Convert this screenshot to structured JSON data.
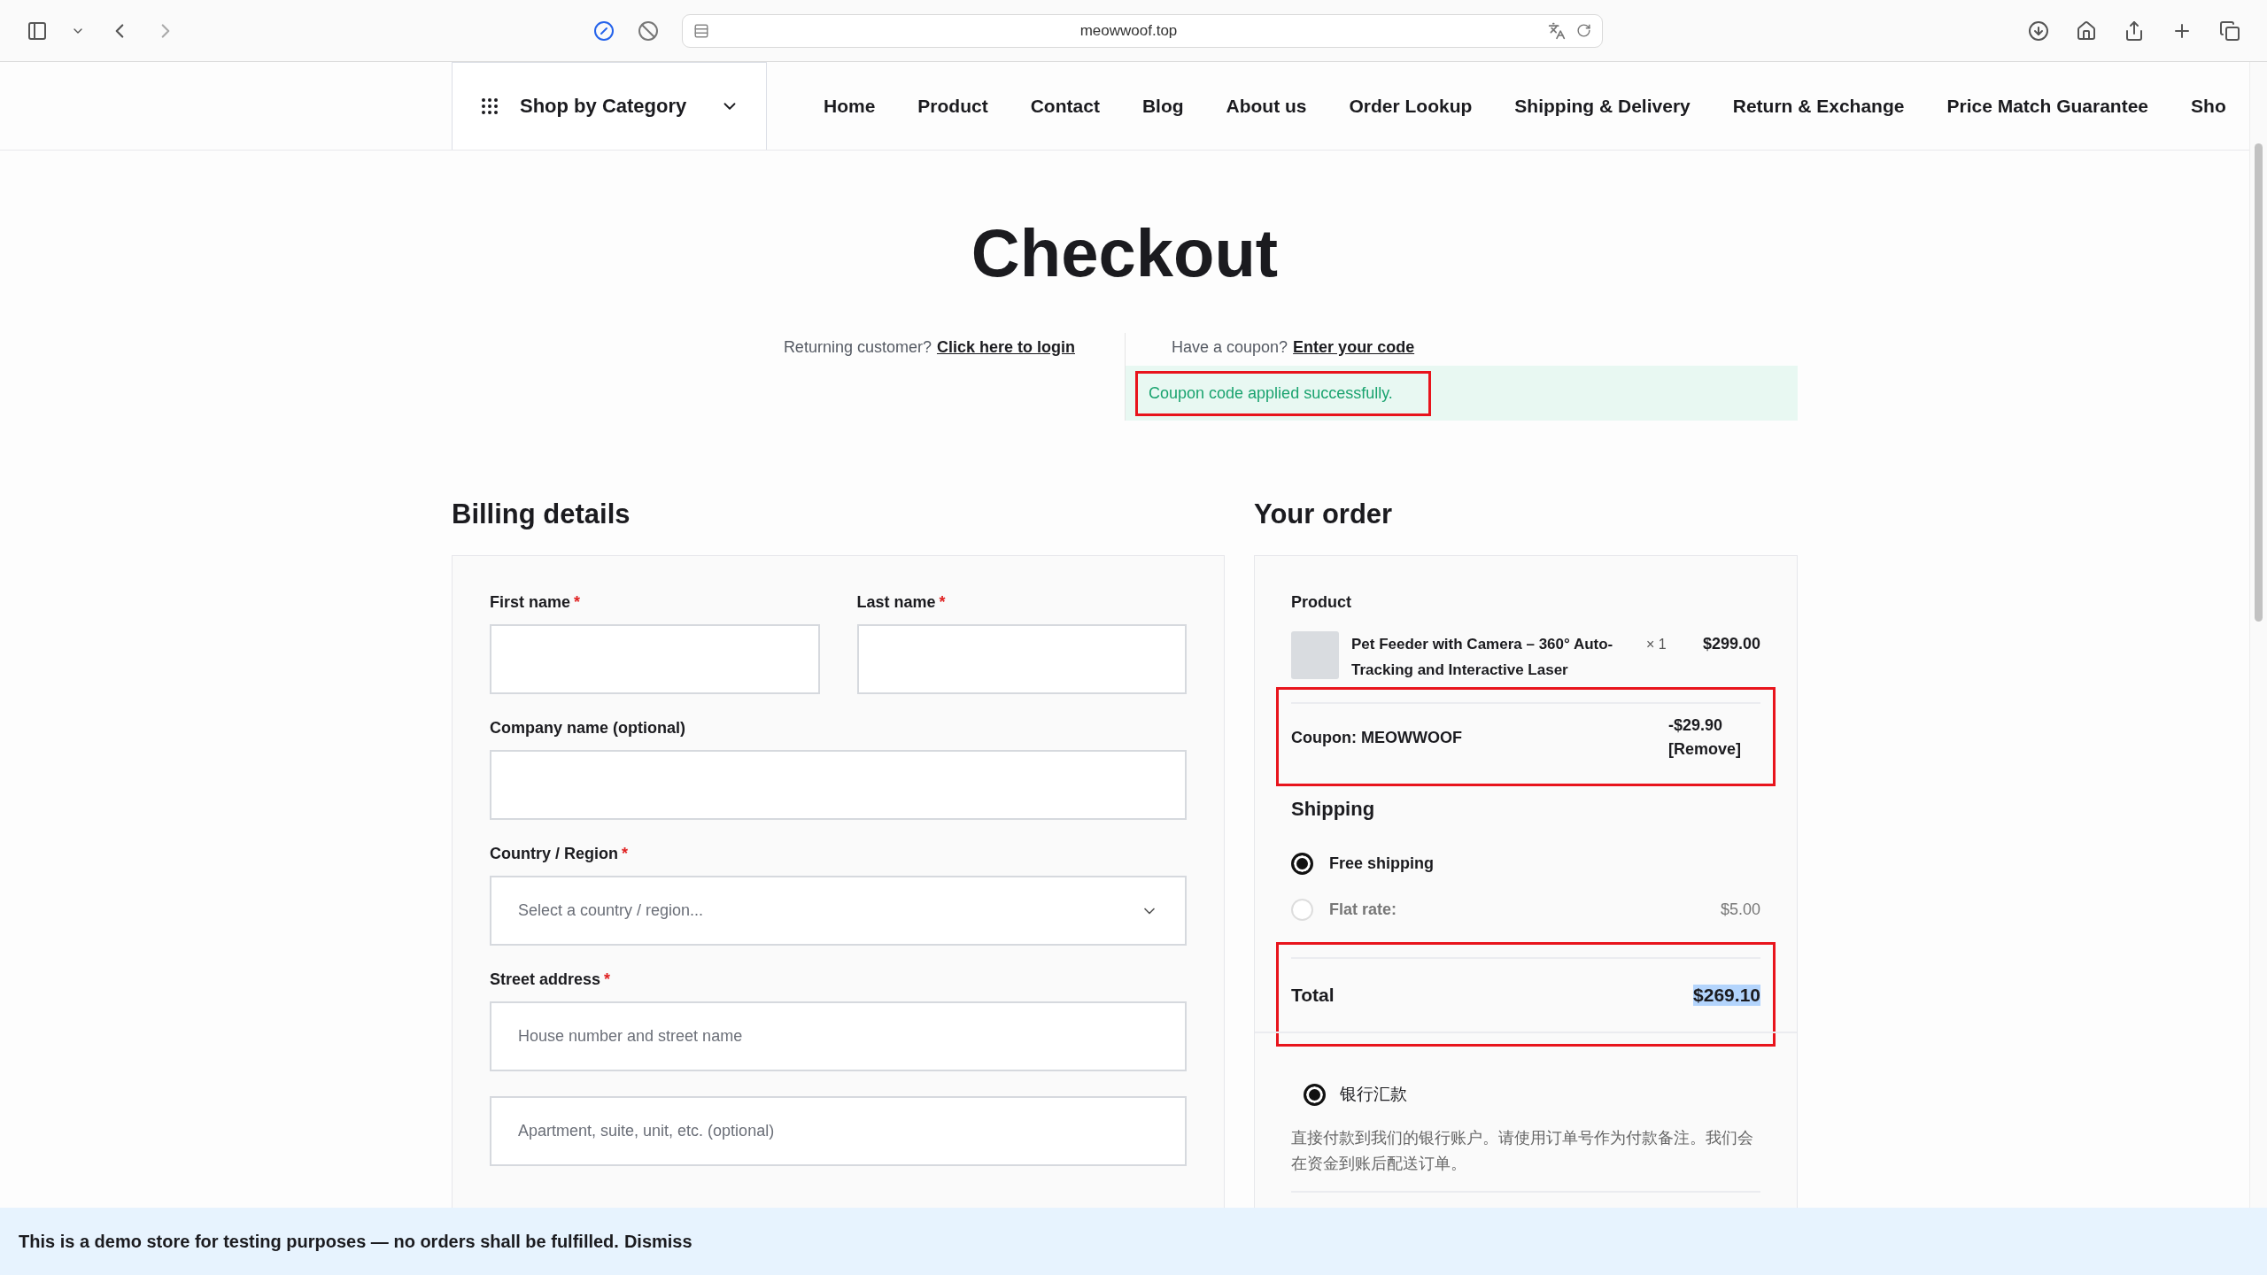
{
  "browser": {
    "url": "meowwoof.top"
  },
  "nav": {
    "category_button": "Shop by Category",
    "items": [
      {
        "label": "Home"
      },
      {
        "label": "Product"
      },
      {
        "label": "Contact"
      },
      {
        "label": "Blog"
      },
      {
        "label": "About us"
      },
      {
        "label": "Order Lookup"
      },
      {
        "label": "Shipping & Delivery"
      },
      {
        "label": "Return & Exchange"
      },
      {
        "label": "Price Match Guarantee"
      },
      {
        "label": "Sho"
      }
    ]
  },
  "title": "Checkout",
  "notices": {
    "login_prompt": "Returning customer?",
    "login_link": "Click here to login",
    "coupon_prompt": "Have a coupon?",
    "coupon_link": "Enter your code",
    "success_message": {
      "text": "Coupon code applied successfully.",
      "highlighted": true
    }
  },
  "billing": {
    "heading": "Billing details",
    "rows": [
      [
        {
          "kind": "input",
          "label": "First name",
          "required_mark": "*"
        },
        {
          "kind": "input",
          "label": "Last name",
          "required_mark": "*"
        }
      ],
      [
        {
          "kind": "input",
          "label": "Company name (optional)"
        }
      ],
      [
        {
          "kind": "select",
          "label": "Country / Region",
          "required_mark": "*",
          "placeholder": "Select a country / region..."
        }
      ],
      [
        {
          "kind": "input",
          "label": "Street address",
          "required_mark": "*",
          "placeholder": "House number and street name"
        }
      ],
      [
        {
          "kind": "input",
          "placeholder": "Apartment, suite, unit, etc. (optional)"
        }
      ]
    ]
  },
  "order": {
    "heading": "Your order",
    "product_header": "Product",
    "items": [
      {
        "name": "Pet Feeder with Camera – 360° Auto-Tracking and Interactive Laser",
        "quantity": "× 1",
        "price": "$299.00"
      }
    ],
    "coupon": {
      "label": "Coupon: MEOWWOOF",
      "amount": "-$29.90",
      "remove": "[Remove]",
      "highlighted": true
    },
    "shipping": {
      "heading": "Shipping",
      "options": [
        {
          "label": "Free shipping",
          "selected": true
        },
        {
          "label": "Flat rate:",
          "price": "$5.00",
          "selected": false
        }
      ]
    },
    "total": {
      "label": "Total",
      "amount": "$269.10",
      "highlighted": true,
      "amount_selected": true
    },
    "payment_methods": [
      {
        "label": "银行汇款",
        "selected": true,
        "description": "直接付款到我们的银行账户。请使用订单号作为付款备注。我们会在资金到账后配送订单。"
      }
    ]
  },
  "store_notice": {
    "text": "This is a demo store for testing purposes — no orders shall be fulfilled.",
    "dismiss": "Dismiss"
  }
}
